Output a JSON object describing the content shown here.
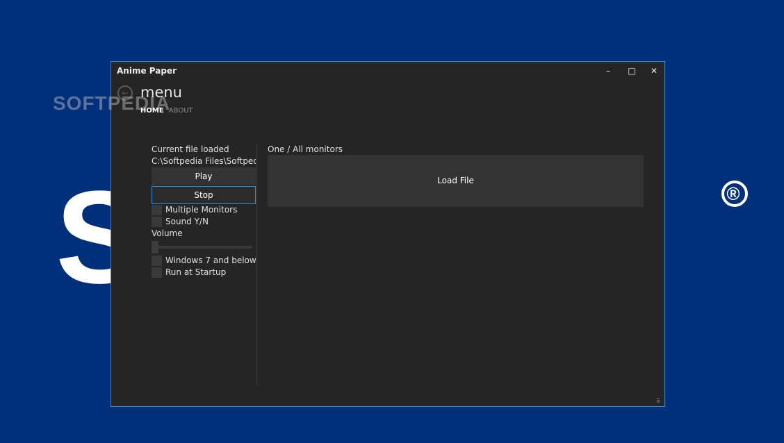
{
  "background": {
    "logo_text": "S    A",
    "registered_mark": "®"
  },
  "window": {
    "title": "Anime Paper",
    "controls": {
      "minimize": "–",
      "maximize": "□",
      "close": "✕"
    },
    "watermark": "SOFTPEDIA"
  },
  "header": {
    "back_icon": "arrow-left-icon",
    "title": "menu",
    "tabs": [
      {
        "label": "HOME",
        "active": true
      },
      {
        "label": "ABOUT",
        "active": false
      }
    ]
  },
  "left": {
    "current_file_label": "Current file loaded",
    "current_file_path": "C:\\Softpedia Files\\Softpedia",
    "play_label": "Play",
    "stop_label": "Stop",
    "multiple_monitors_label": "Multiple Monitors",
    "sound_label": "Sound Y/N",
    "volume_label": "Volume",
    "volume_value": 0,
    "windows7_label": "Windows 7 and below",
    "startup_label": "Run at Startup"
  },
  "right": {
    "monitors_label": "One / All monitors",
    "load_file_label": "Load File"
  },
  "colors": {
    "desktop": "#022f7a",
    "window_bg": "#252525",
    "accent": "#2d8fd4"
  }
}
